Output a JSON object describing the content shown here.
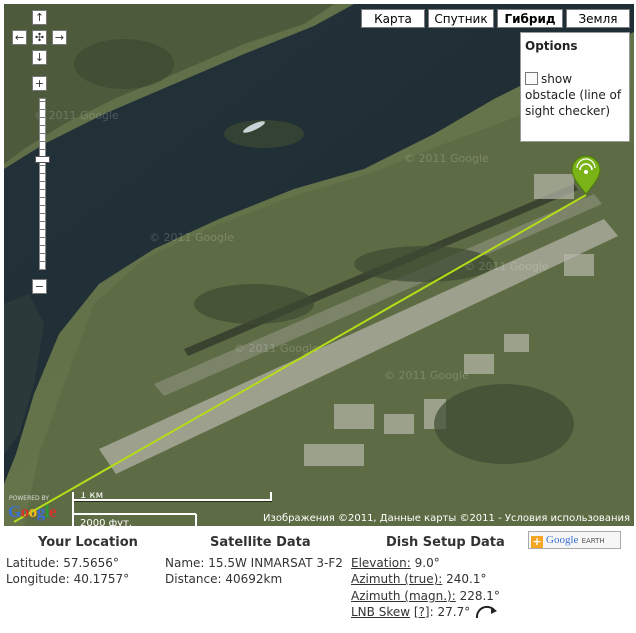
{
  "map": {
    "map_types": [
      "Карта",
      "Спутник",
      "Гибрид",
      "Земля"
    ],
    "active_map_type": "Гибрид",
    "zoom_in_label": "+",
    "zoom_out_label": "−",
    "options": {
      "title": "Options",
      "show_obstacle_label": "show obstacle (line of sight checker)",
      "show_obstacle_checked": false
    },
    "scale": {
      "metric": "1 км",
      "imperial": "2000 фут."
    },
    "copyright": "Изображения ©2011, Данные карты ©2011 - Условия использования",
    "powered_by": "POWERED BY",
    "google_logo": "Google",
    "watermark": "© 2011 Google",
    "marker_color": "#7ab317",
    "sightline_color": "#b5dc18"
  },
  "your_location": {
    "heading": "Your Location",
    "latitude_label": "Latitude:",
    "latitude_value": "57.5656°",
    "longitude_label": "Longitude:",
    "longitude_value": "40.1757°"
  },
  "satellite_data": {
    "heading": "Satellite Data",
    "name_label": "Name:",
    "name_value": "15.5W INMARSAT 3-F2",
    "distance_label": "Distance:",
    "distance_value": "40692km"
  },
  "dish_setup": {
    "heading": "Dish Setup Data",
    "elevation_label": "Elevation:",
    "elevation_value": "9.0°",
    "azimuth_true_label": "Azimuth (true):",
    "azimuth_true_value": "240.1°",
    "azimuth_magn_label": "Azimuth (magn.):",
    "azimuth_magn_value": "228.1°",
    "lnb_skew_label": "LNB Skew",
    "lnb_skew_help": "[?]",
    "lnb_skew_colon": ":",
    "lnb_skew_value": "27.7°"
  },
  "google_earth_button": {
    "brand": "Google",
    "suffix": "EARTH"
  }
}
